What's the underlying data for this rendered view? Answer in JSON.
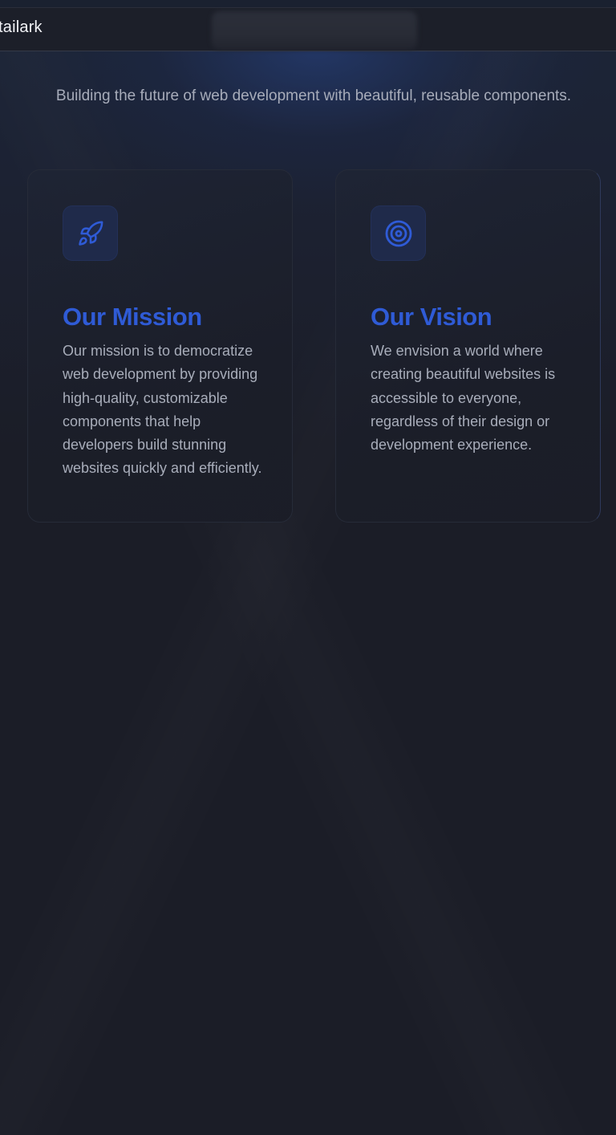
{
  "header": {
    "brand": "tailark"
  },
  "hero": {
    "subtitle": "Building the future of web development with beautiful, reusable components."
  },
  "cards": [
    {
      "icon": "rocket-icon",
      "title": "Our Mission",
      "text": "Our mission is to democratize web development by providing high-quality, customizable components that help developers build stunning websites quickly and efficiently."
    },
    {
      "icon": "target-icon",
      "title": "Our Vision",
      "text": "We envision a world where creating beautiful websites is accessible to everyone, regardless of their design or development experience."
    }
  ],
  "colors": {
    "accent": "#2f5bd6",
    "background": "#1b1d27",
    "icon_tile": "#1f2a4a"
  }
}
